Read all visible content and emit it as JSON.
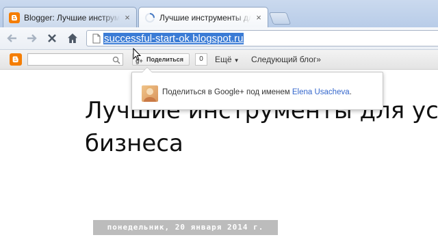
{
  "browser": {
    "tabs": [
      {
        "title": "Blogger: Лучшие инструменты для",
        "close": "×",
        "active": false
      },
      {
        "title": "Лучшие инструменты для ус",
        "close": "×",
        "active": true
      }
    ],
    "url": "successful-start-ok.blogspot.ru",
    "icons": {
      "back": "back-arrow-icon",
      "forward": "forward-arrow-icon",
      "stop": "stop-icon",
      "home": "home-icon",
      "page": "page-icon"
    }
  },
  "blogger_navbar": {
    "search_value": "",
    "share_label": "Поделиться",
    "share_count": "0",
    "more_label": "Ещё",
    "next_blog_label": "Следующий блог»",
    "colors": {
      "blogger_orange": "#f57d00"
    }
  },
  "popup": {
    "prefix": "Поделиться в Google+ под именем ",
    "user_name": "Elena Usacheva",
    "suffix": "."
  },
  "post": {
    "title_line1": "Лучшие инструменты для ус",
    "title_line2": "бизнеса",
    "date_header": "понедельник, 20 января 2014 г."
  }
}
